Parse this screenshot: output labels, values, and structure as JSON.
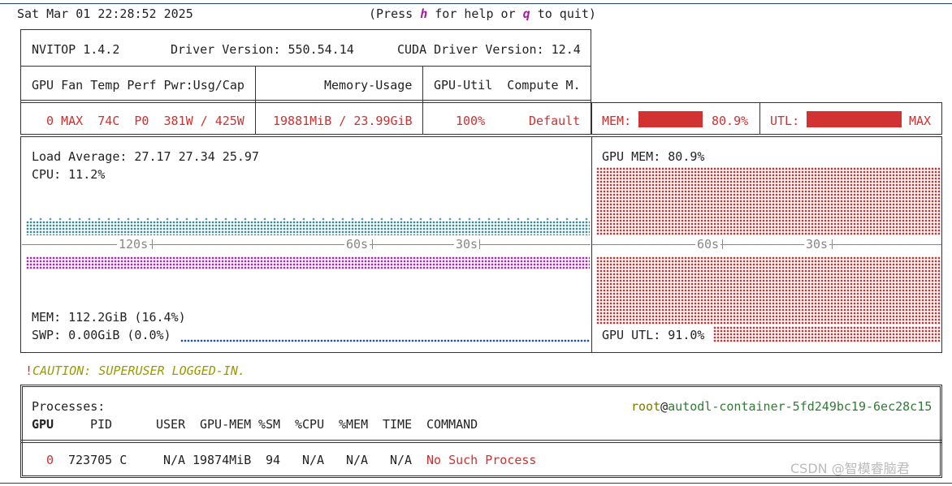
{
  "header": {
    "datetime": "Sat Mar 01 22:28:52 2025",
    "help_prefix": "(Press ",
    "help_key_h": "h",
    "help_mid": " for help or ",
    "help_key_q": "q",
    "help_suffix": " to quit)"
  },
  "device_box": {
    "app": "NVITOP 1.4.2",
    "driver": "Driver Version: 550.54.14",
    "cuda": "CUDA Driver Version: 12.4",
    "col_gpu": "GPU Fan Temp Perf Pwr:Usg/Cap",
    "col_mem": "Memory-Usage",
    "col_util": "GPU-Util  Compute M.",
    "row_gpu": "0 MAX  74C  P0  381W / 425W",
    "row_mem": "19881MiB / 23.99GiB",
    "row_util": "100%",
    "row_compute": "Default",
    "mem_label": "MEM:",
    "mem_pct": "80.9%",
    "mem_fraction": 0.809,
    "utl_label": "UTL:",
    "utl_value": "MAX",
    "utl_fraction": 1.0
  },
  "host_panel": {
    "load_avg": "Load Average: 27.17 27.34 25.97",
    "cpu": "CPU: 11.2%",
    "mem": "MEM: 112.2GiB (16.4%)",
    "swp": "SWP: 0.00GiB (0.0%)",
    "axis_120s": "120s",
    "axis_60s": "60s",
    "axis_30s": "30s"
  },
  "gpu_panel": {
    "gpu_mem": "GPU MEM: 80.9%",
    "gpu_utl": "GPU UTL: 91.0%",
    "axis_60s": "60s",
    "axis_30s": "30s"
  },
  "caution": {
    "bang": "!",
    "text": "CAUTION: SUPERUSER LOGGED-IN."
  },
  "processes": {
    "title": "Processes:",
    "user": "root",
    "at": "@",
    "host": "autodl-container-5fd249bc19-6ec28c15",
    "columns": [
      "GPU",
      "PID",
      "USER",
      "GPU-MEM",
      "%SM",
      "%CPU",
      "%MEM",
      "TIME",
      "COMMAND"
    ],
    "rows": [
      {
        "gpu": "0",
        "pid": "723705 C",
        "user": "N/A",
        "gpu_mem": "19874MiB",
        "sm": "94",
        "cpu": "N/A",
        "mem": "N/A",
        "time": "N/A",
        "command": "No Such Process"
      }
    ]
  },
  "watermark": "CSDN @智模睿脑君",
  "colors": {
    "bar_red": "#d23232",
    "cpu_teal": "#1a7f8c",
    "mem_magenta": "#b020c0",
    "swp_blue": "#2050b0",
    "gpu_red": "#cc3333"
  }
}
